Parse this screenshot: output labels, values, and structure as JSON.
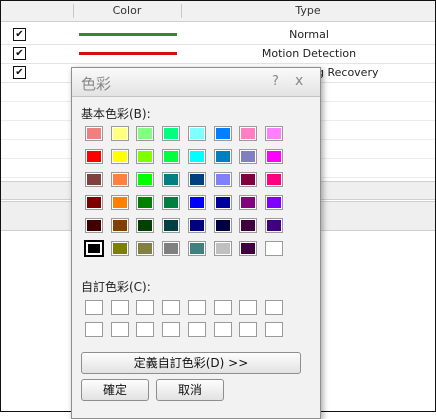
{
  "table": {
    "headers": {
      "color": "Color",
      "type": "Type"
    },
    "rows": [
      {
        "checked": true,
        "check_mark": "✔",
        "line_color": "#2e8b2e",
        "type": "Normal"
      },
      {
        "checked": true,
        "check_mark": "✔",
        "line_color": "#d01010",
        "type": "Motion Detection"
      },
      {
        "checked": true,
        "check_mark": "✔",
        "line_color": "#1f2fa0",
        "type": "g Recovery"
      }
    ]
  },
  "dialog": {
    "title": "色彩",
    "help": "?",
    "close": "x",
    "basic_label": "基本色彩(B):",
    "custom_label": "自訂色彩(C):",
    "define_button": "定義自訂色彩(D) >>",
    "ok_button": "確定",
    "cancel_button": "取消",
    "selected_color": "#000000",
    "basic_colors": [
      [
        "#f08080",
        "#ffff80",
        "#80ff80",
        "#00ff80",
        "#80ffff",
        "#0080ff",
        "#ff80c0",
        "#ff80ff"
      ],
      [
        "#ff0000",
        "#ffff00",
        "#80ff00",
        "#00ff40",
        "#00ffff",
        "#0080c0",
        "#8080c0",
        "#ff00ff"
      ],
      [
        "#804040",
        "#ff8040",
        "#00ff00",
        "#008080",
        "#004080",
        "#8080ff",
        "#800040",
        "#ff0080"
      ],
      [
        "#800000",
        "#ff8000",
        "#008000",
        "#008040",
        "#0000ff",
        "#0000a0",
        "#800080",
        "#8000ff"
      ],
      [
        "#400000",
        "#804000",
        "#004000",
        "#004040",
        "#000080",
        "#000040",
        "#400040",
        "#400080"
      ],
      [
        "#000000",
        "#808000",
        "#808040",
        "#808080",
        "#408080",
        "#c0c0c0",
        "#400040",
        "#ffffff"
      ]
    ],
    "custom_colors": [
      [
        "#ffffff",
        "#ffffff",
        "#ffffff",
        "#ffffff",
        "#ffffff",
        "#ffffff",
        "#ffffff",
        "#ffffff"
      ],
      [
        "#ffffff",
        "#ffffff",
        "#ffffff",
        "#ffffff",
        "#ffffff",
        "#ffffff",
        "#ffffff",
        "#ffffff"
      ]
    ]
  }
}
